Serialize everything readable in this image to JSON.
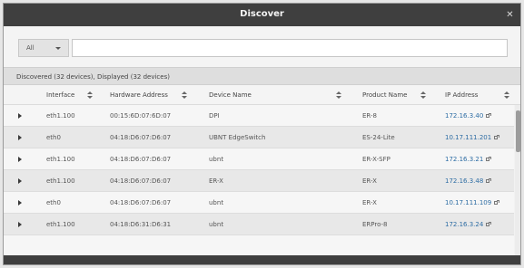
{
  "window": {
    "title": "Discover",
    "close_glyph": "✕"
  },
  "filter": {
    "scope_selected": "All",
    "search_value": ""
  },
  "summary": {
    "text": "Discovered (32 devices), Displayed (32 devices)"
  },
  "table": {
    "columns": [
      "Interface",
      "Hardware Address",
      "Device Name",
      "Product Name",
      "IP Address"
    ],
    "rows": [
      {
        "interface": "eth1.100",
        "hw": "00:15:6D:07:6D:07",
        "name": "DPI",
        "product": "ER-8",
        "ip": "172.16.3.40"
      },
      {
        "interface": "eth0",
        "hw": "04:18:D6:07:D6:07",
        "name": "UBNT EdgeSwitch",
        "product": "ES-24-Lite",
        "ip": "10.17.111.201"
      },
      {
        "interface": "eth1.100",
        "hw": "04:18:D6:07:D6:07",
        "name": "ubnt",
        "product": "ER-X-SFP",
        "ip": "172.16.3.21"
      },
      {
        "interface": "eth1.100",
        "hw": "04:18:D6:07:D6:07",
        "name": "ER-X",
        "product": "ER-X",
        "ip": "172.16.3.48"
      },
      {
        "interface": "eth0",
        "hw": "04:18:D6:07:D6:07",
        "name": "ubnt",
        "product": "ER-X",
        "ip": "10.17.111.109"
      },
      {
        "interface": "eth1.100",
        "hw": "04:18:D6:31:D6:31",
        "name": "ubnt",
        "product": "ERPro-8",
        "ip": "172.16.3.24"
      },
      {
        "interface": "",
        "hw": "",
        "name": "",
        "product": "",
        "ip": ""
      }
    ]
  },
  "icons": {
    "close": "close-icon",
    "sort": "sort-icon",
    "expand": "expand-arrow-icon",
    "external_link": "external-link-icon",
    "dropdown": "chevron-down-icon"
  },
  "colors": {
    "titlebar": "#3f3f3f",
    "link": "#2e6da4",
    "row_odd": "#f6f6f6",
    "row_even": "#e8e8e8"
  }
}
